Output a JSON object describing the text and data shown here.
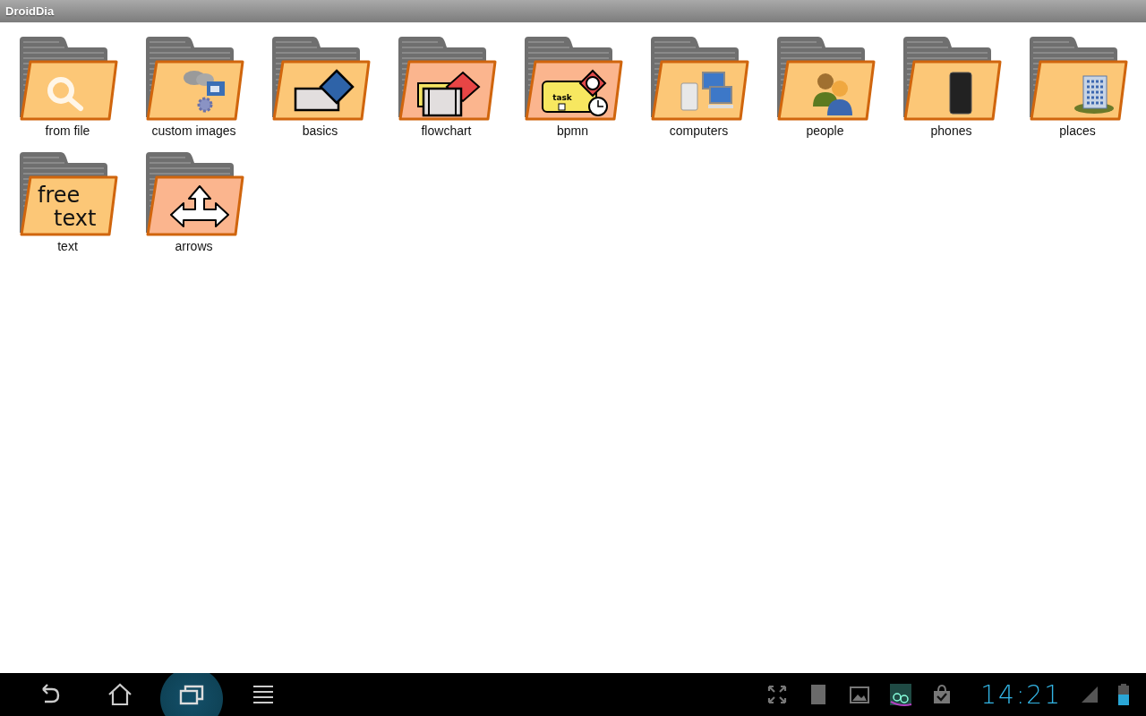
{
  "window": {
    "title": "DroidDia"
  },
  "folders": [
    {
      "label": "from file",
      "kind": "search"
    },
    {
      "label": "custom images",
      "kind": "images"
    },
    {
      "label": "basics",
      "kind": "basics"
    },
    {
      "label": "flowchart",
      "kind": "flowchart"
    },
    {
      "label": "bpmn",
      "kind": "bpmn",
      "emblem_text": [
        "task"
      ]
    },
    {
      "label": "computers",
      "kind": "computers"
    },
    {
      "label": "people",
      "kind": "people"
    },
    {
      "label": "phones",
      "kind": "phones"
    },
    {
      "label": "places",
      "kind": "places"
    },
    {
      "label": "text",
      "kind": "text",
      "emblem_text": [
        "free",
        "text"
      ]
    },
    {
      "label": "arrows",
      "kind": "arrows"
    }
  ],
  "navigation_bar": {
    "buttons": [
      {
        "kind": "back",
        "selected": false
      },
      {
        "kind": "home",
        "selected": false
      },
      {
        "kind": "recents",
        "selected": true
      },
      {
        "kind": "menu",
        "selected": false
      }
    ],
    "status_icons": [
      {
        "kind": "expand"
      },
      {
        "kind": "sdcard"
      },
      {
        "kind": "gallery"
      },
      {
        "kind": "thumbnail"
      },
      {
        "kind": "store"
      }
    ],
    "clock": "14:21"
  }
}
